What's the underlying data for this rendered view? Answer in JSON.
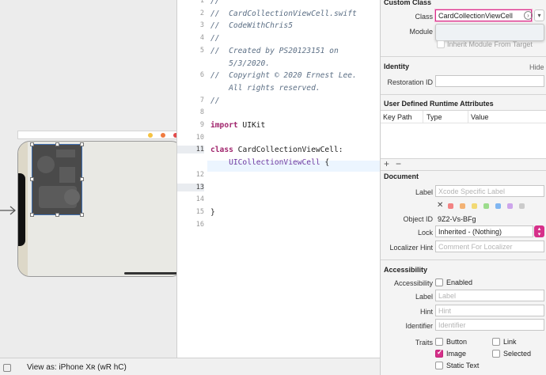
{
  "canvas": {
    "scene_dot_colors": [
      "#f5c242",
      "#f07b3f",
      "#e24b4b"
    ]
  },
  "editor": {
    "lines": [
      {
        "n": "1",
        "text": "//"
      },
      {
        "n": "2",
        "text": "//  CardCollectionViewCell.swift"
      },
      {
        "n": "3",
        "text": "//  CodeWithChris5"
      },
      {
        "n": "4",
        "text": "//"
      },
      {
        "n": "5",
        "text": "//  Created by PS20123151 on"
      },
      {
        "n": "",
        "text": "    5/3/2020."
      },
      {
        "n": "6",
        "text": "//  Copyright © 2020 Ernest Lee."
      },
      {
        "n": "",
        "text": "    All rights reserved."
      },
      {
        "n": "7",
        "text": "//"
      },
      {
        "n": "8",
        "text": ""
      },
      {
        "n": "9",
        "kw": "import",
        "rest": " UIKit"
      },
      {
        "n": "10",
        "text": ""
      },
      {
        "n": "11",
        "kw": "class",
        "rest": " CardCollectionViewCell:"
      },
      {
        "n": "",
        "ty": "    UICollectionViewCell",
        "rest": " {"
      },
      {
        "n": "12",
        "text": ""
      },
      {
        "n": "13",
        "text": ""
      },
      {
        "n": "14",
        "text": ""
      },
      {
        "n": "15",
        "rest": "}"
      },
      {
        "n": "16",
        "text": ""
      }
    ]
  },
  "inspector": {
    "custom_class": {
      "title": "Custom Class",
      "class_label": "Class",
      "class_value": "CardCollectionViewCell",
      "module_label": "Module",
      "inherit_label": "Inherit Module From Target"
    },
    "identity": {
      "title": "Identity",
      "hide_label": "Hide",
      "restoration_id_label": "Restoration ID"
    },
    "runtime_attributes": {
      "title": "User Defined Runtime Attributes",
      "columns": [
        "Key Path",
        "Type",
        "Value"
      ],
      "add_icon": "plus-icon",
      "remove_icon": "minus-icon"
    },
    "document": {
      "title": "Document",
      "label_label": "Label",
      "label_placeholder": "Xcode Specific Label",
      "color_tags": [
        "#f25d5d",
        "#f39c4a",
        "#f2d04a",
        "#7fd46a",
        "#5aa2f0",
        "#c08be8",
        "#bdbdbd"
      ],
      "object_id_label": "Object ID",
      "object_id_value": "9Z2-Vs-BFg",
      "lock_label": "Lock",
      "lock_value": "Inherited - (Nothing)",
      "localizer_label": "Localizer Hint",
      "localizer_placeholder": "Comment For Localizer"
    },
    "accessibility": {
      "title": "Accessibility",
      "accessibility_label": "Accessibility",
      "enabled_label": "Enabled",
      "label_label": "Label",
      "label_placeholder": "Label",
      "hint_label": "Hint",
      "hint_placeholder": "Hint",
      "identifier_label": "Identifier",
      "identifier_placeholder": "Identifier",
      "traits_label": "Traits",
      "traits": [
        {
          "label": "Button",
          "checked": false
        },
        {
          "label": "Link",
          "checked": false
        },
        {
          "label": "Image",
          "checked": true
        },
        {
          "label": "Selected",
          "checked": false
        },
        {
          "label": "Static Text",
          "checked": false
        }
      ]
    },
    "accent_color": "#d6308a"
  },
  "bottombar": {
    "view_as": "View as: iPhone Xʀ (wR hC)"
  }
}
